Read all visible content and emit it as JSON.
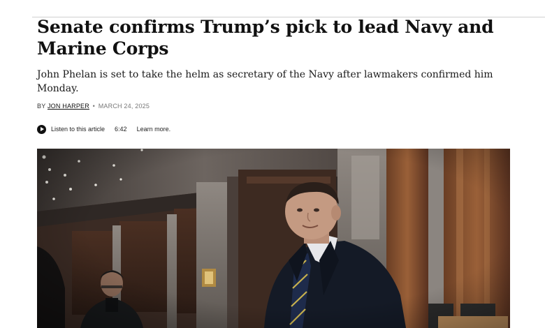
{
  "article": {
    "headline": "Senate confirms Trump’s pick to lead Navy and Marine Corps",
    "dek": "John Phelan is set to take the helm as secretary of the Navy after lawmakers confirmed him Monday.",
    "byline": {
      "prefix": "BY",
      "author": "JON HARPER",
      "separator": "•",
      "date": "MARCH 24, 2025"
    },
    "audio": {
      "icon": "play-icon",
      "listen_label": "Listen to this article",
      "duration": "6:42",
      "learn_more": "Learn more."
    }
  },
  "colors": {
    "headline": "#111111",
    "meta_gray": "#777777",
    "photo_wood": "#7a4a2c"
  }
}
